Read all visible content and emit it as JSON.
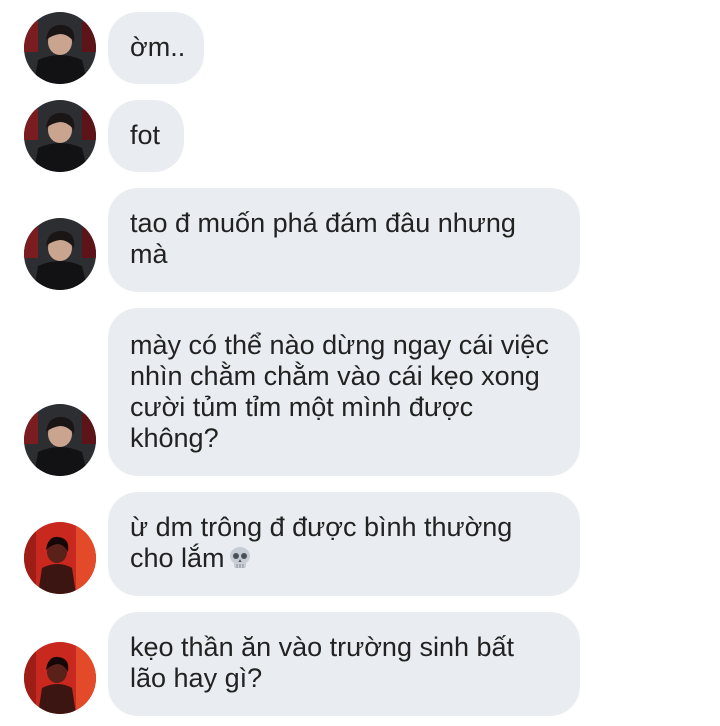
{
  "messages": [
    {
      "sender": "friend-a",
      "lines": [
        "ờm.."
      ]
    },
    {
      "sender": "friend-a",
      "lines": [
        "fot"
      ]
    },
    {
      "sender": "friend-a",
      "lines": [
        "tao đ muốn phá đám đâu nhưng",
        "mà"
      ]
    },
    {
      "sender": "friend-a",
      "lines": [
        "mày có thể nào dừng ngay cái việc",
        "nhìn chằm chằm vào cái kẹo xong",
        "cười tủm tỉm một mình được",
        "không?"
      ]
    },
    {
      "sender": "friend-b",
      "lines": [
        "ừ dm trông đ được bình thường",
        "cho lắm"
      ],
      "emoji": "skull-icon"
    },
    {
      "sender": "friend-b",
      "lines": [
        "kẹo thần ăn vào trường sinh bất",
        "lão hay gì?"
      ]
    }
  ],
  "colors": {
    "bubble": "#e9ecf0",
    "text": "#222222",
    "avatar_a_bg": "#2a2b2e",
    "avatar_b_bg": "#c8281e"
  }
}
